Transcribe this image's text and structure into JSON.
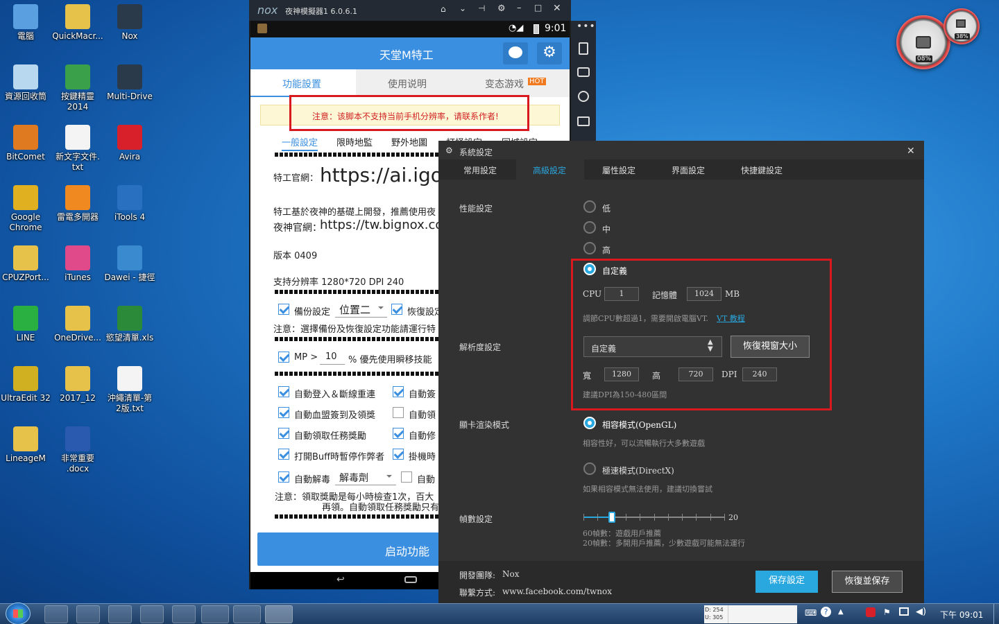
{
  "desktop": {
    "icons": [
      {
        "label": "電腦",
        "color": "#5aa0e0"
      },
      {
        "label": "QuickMacr...",
        "color": "#e6c24a"
      },
      {
        "label": "Nox",
        "color": "#2a3a4a"
      },
      {
        "label": "資源回收筒",
        "color": "#b8d8f0"
      },
      {
        "label": "按鍵精靈\n2014",
        "color": "#3aa04a"
      },
      {
        "label": "Multi-Drive",
        "color": "#2a3a4a"
      },
      {
        "label": "BitComet",
        "color": "#e07a20"
      },
      {
        "label": "新文字文件.\ntxt",
        "color": "#f4f4f4"
      },
      {
        "label": "Avira",
        "color": "#d8202a"
      },
      {
        "label": "Google\nChrome",
        "color": "#e0b020"
      },
      {
        "label": "雷電多開器",
        "color": "#f08a20"
      },
      {
        "label": "iTools 4",
        "color": "#2a70c0"
      },
      {
        "label": "CPUZPort...",
        "color": "#e6c24a"
      },
      {
        "label": "iTunes",
        "color": "#e04a8a"
      },
      {
        "label": "Dawei - 捷徑",
        "color": "#3a8ad0"
      },
      {
        "label": "LINE",
        "color": "#2ab040"
      },
      {
        "label": "OneDrive...",
        "color": "#e6c24a"
      },
      {
        "label": "慾望清單.xls",
        "color": "#2a8a3a"
      },
      {
        "label": "UltraEdit 32",
        "color": "#d0b020"
      },
      {
        "label": "2017_12",
        "color": "#e6c24a"
      },
      {
        "label": "沖繩清單-第\n2版.txt",
        "color": "#f4f4f4"
      },
      {
        "label": "LineageM",
        "color": "#e6c24a"
      },
      {
        "label": "非常重要\n.docx",
        "color": "#2a5ab0"
      }
    ],
    "gadget": {
      "cpu": "08%",
      "mem": "38%"
    }
  },
  "nox": {
    "title": "夜神模擬器1 6.0.6.1",
    "logo": "nox",
    "time": "9:01",
    "app_title": "天堂M特工",
    "tabs": [
      "功能設置",
      "使用说明",
      "变态游戏"
    ],
    "hot": "HOT",
    "warning": "注意：该脚本不支持当前手机分辨率，请联系作者!",
    "subtabs": [
      "一般設定",
      "限時地監",
      "野外地圖",
      "打怪設定",
      "回城設定"
    ],
    "site_label": "特工官網：",
    "site_url": "https://ai.igo",
    "intro1": "特工基於夜神的基礎上開發，推薦使用夜",
    "intro2_label": "夜神官網：",
    "intro2_url": "https://tw.bignox.co",
    "version": "版本 0409",
    "resolution": "支持分辨率 1280*720 DPI 240",
    "backup_label": "備份設定",
    "backup_select": "位置二",
    "restore_label": "恢復設定",
    "note1": "注意：選擇備份及恢復設定功能請運行特",
    "mp_label": "MP >",
    "mp_value": "10",
    "mp_suffix": "% 優先使用瞬移技能",
    "opts": [
      {
        "label": "自動登入＆斷線重連",
        "on": true
      },
      {
        "label": "自動簽",
        "on": true
      },
      {
        "label": "自動血盟簽到及領獎",
        "on": true
      },
      {
        "label": "自動領",
        "on": false
      },
      {
        "label": "自動領取任務獎勵",
        "on": true
      },
      {
        "label": "自動修",
        "on": true
      },
      {
        "label": "打開Buff時暫停作弊者",
        "on": true
      },
      {
        "label": "掛機時",
        "on": true
      }
    ],
    "detox_label": "自動解毒",
    "detox_select": "解毒劑",
    "auto_label": "自動",
    "note2a": "注意：領取獎勵是每小時檢查1次，百大",
    "note2b": "再領。自動領取任務獎勵只有",
    "start_button": "启动功能"
  },
  "dialog": {
    "title": "系統設定",
    "tabs": [
      "常用設定",
      "高級設定",
      "屬性設定",
      "界面設定",
      "快捷鍵設定"
    ],
    "active_tab": 1,
    "perf_label": "性能設定",
    "perf_opts": [
      "低",
      "中",
      "高",
      "自定義"
    ],
    "cpu_label": "CPU",
    "cpu_value": "1",
    "mem_label": "記憶體",
    "mem_value": "1024",
    "mem_unit": "MB",
    "vt_hint": "調節CPU數超過1，需要開啟電腦VT.",
    "vt_link": "VT 教程",
    "res_label": "解析度設定",
    "res_select": "自定義",
    "restore_btn": "恢復視窗大小",
    "w_label": "寬",
    "w_value": "1280",
    "h_label": "高",
    "h_value": "720",
    "dpi_label": "DPI",
    "dpi_value": "240",
    "dpi_hint": "建議DPI為150-480區間",
    "render_label": "顯卡渲染模式",
    "opengl": "相容模式(OpenGL)",
    "opengl_hint": "相容性好，可以流暢執行大多數遊戲",
    "directx": "極速模式(DirectX)",
    "directx_hint": "如果相容模式無法使用，建議切換嘗試",
    "fps_label": "幀數設定",
    "fps_value": "20",
    "fps_level": 0.2,
    "fps_hint1": "60幀數：遊戲用戶推薦",
    "fps_hint2": "20幀數：多開用戶推薦，少數遊戲可能無法運行",
    "team_label": "開發團隊:",
    "team_value": "Nox",
    "contact_label": "聯繫方式:",
    "contact_value": "www.facebook.com/twnox",
    "save_btn": "保存設定",
    "reset_btn": "恢復並保存",
    "accent": "#29a8e0"
  },
  "taskbar": {
    "net_d": "D: 254",
    "net_u": "U: 305",
    "clock": "下午 09:01"
  }
}
